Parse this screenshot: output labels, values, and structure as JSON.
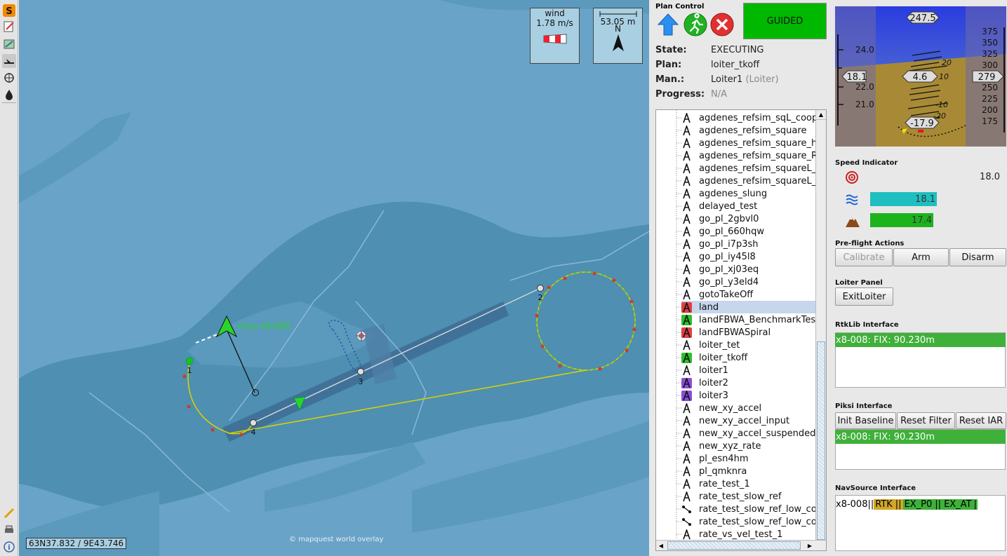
{
  "map": {
    "wind_label": "wind",
    "wind_speed": "1.78 m/s",
    "scale_value": "53.05 m",
    "north_label": "N",
    "aircraft_label": "ntnu-x8-008",
    "coordinates": "63N37.832 / 9E43.746",
    "credit": "© mapquest world overlay",
    "waypoints": [
      "1",
      "2",
      "3",
      "4"
    ]
  },
  "plan_control": {
    "title": "Plan Control",
    "mode": "GUIDED",
    "state_label": "State:",
    "state_value": "EXECUTING",
    "plan_label": "Plan:",
    "plan_value": "loiter_tkoff",
    "man_label": "Man.:",
    "man_value": "Loiter1",
    "man_type": "(Loiter)",
    "progress_label": "Progress:",
    "progress_value": "N/A"
  },
  "plans": [
    {
      "name": "agdenes_refsim_sqL_coop",
      "icon": "plan-icon",
      "color": "#111"
    },
    {
      "name": "agdenes_refsim_square",
      "icon": "plan-icon",
      "color": "#111"
    },
    {
      "name": "agdenes_refsim_square_he",
      "icon": "plan-icon",
      "color": "#111"
    },
    {
      "name": "agdenes_refsim_square_RT",
      "icon": "plan-icon",
      "color": "#111"
    },
    {
      "name": "agdenes_refsim_squareL_c",
      "icon": "plan-icon",
      "color": "#111"
    },
    {
      "name": "agdenes_refsim_squareL_R",
      "icon": "plan-icon",
      "color": "#111"
    },
    {
      "name": "agdenes_slung",
      "icon": "plan-icon",
      "color": "#111"
    },
    {
      "name": "delayed_test",
      "icon": "plan-icon",
      "color": "#111"
    },
    {
      "name": "go_pl_2gbvl0",
      "icon": "plan-icon",
      "color": "#111"
    },
    {
      "name": "go_pl_660hqw",
      "icon": "plan-icon",
      "color": "#111"
    },
    {
      "name": "go_pl_i7p3sh",
      "icon": "plan-icon",
      "color": "#111"
    },
    {
      "name": "go_pl_iy45l8",
      "icon": "plan-icon",
      "color": "#111"
    },
    {
      "name": "go_pl_xj03eq",
      "icon": "plan-icon",
      "color": "#111"
    },
    {
      "name": "go_pl_y3eld4",
      "icon": "plan-icon",
      "color": "#111"
    },
    {
      "name": "gotoTakeOff",
      "icon": "plan-icon",
      "color": "#111"
    },
    {
      "name": "land",
      "icon": "plan-icon-red",
      "color": "#e04040",
      "selected": true
    },
    {
      "name": "landFBWA_BenchmarkTest",
      "icon": "plan-icon-green",
      "color": "#2dbf2d"
    },
    {
      "name": "landFBWASpiral",
      "icon": "plan-icon-red",
      "color": "#e04040"
    },
    {
      "name": "loiter_tet",
      "icon": "plan-icon",
      "color": "#111"
    },
    {
      "name": "loiter_tkoff",
      "icon": "plan-icon-green",
      "color": "#2dbf2d"
    },
    {
      "name": "loiter1",
      "icon": "plan-icon",
      "color": "#111"
    },
    {
      "name": "loiter2",
      "icon": "plan-icon-purple",
      "color": "#8a4fd8"
    },
    {
      "name": "loiter3",
      "icon": "plan-icon-purple",
      "color": "#8a4fd8"
    },
    {
      "name": "new_xy_accel",
      "icon": "plan-icon",
      "color": "#111"
    },
    {
      "name": "new_xy_accel_input",
      "icon": "plan-icon",
      "color": "#111"
    },
    {
      "name": "new_xy_accel_suspended",
      "icon": "plan-icon",
      "color": "#111"
    },
    {
      "name": "new_xyz_rate",
      "icon": "plan-icon",
      "color": "#111"
    },
    {
      "name": "pl_esn4hm",
      "icon": "plan-icon",
      "color": "#111"
    },
    {
      "name": "pl_qmknra",
      "icon": "plan-icon",
      "color": "#111"
    },
    {
      "name": "rate_test_1",
      "icon": "plan-icon",
      "color": "#111"
    },
    {
      "name": "rate_test_slow_ref",
      "icon": "plan-icon",
      "color": "#111"
    },
    {
      "name": "rate_test_slow_ref_low_cop",
      "icon": "branch-icon",
      "color": "#111"
    },
    {
      "name": "rate_test_slow_ref_low_cop",
      "icon": "branch-icon",
      "color": "#111"
    },
    {
      "name": "rate_vs_vel_test_1",
      "icon": "plan-icon",
      "color": "#111"
    }
  ],
  "pfd": {
    "speed_tape": [
      "24.0",
      "22.0",
      "21.0"
    ],
    "speed_value": "18.1",
    "heading": "247.5",
    "pitch_value": "4.6",
    "roll_value": "-17.9",
    "pitch_ticks": [
      "20",
      "10",
      "-10",
      "-20"
    ],
    "altitude_tape": [
      "375",
      "350",
      "325",
      "300",
      "250",
      "225",
      "200",
      "175"
    ],
    "altitude_value": "279"
  },
  "speed_indicator": {
    "title": "Speed Indicator",
    "target": "18.0",
    "airspeed": "18.1",
    "airspeed_fraction": 0.9,
    "groundspeed": "17.4",
    "groundspeed_fraction": 0.85
  },
  "preflight": {
    "title": "Pre-flight Actions",
    "calibrate": "Calibrate",
    "arm": "Arm",
    "disarm": "Disarm"
  },
  "loiter": {
    "title": "Loiter Panel",
    "exit": "ExitLoiter"
  },
  "rtklib": {
    "title": "RtkLib Interface",
    "status": "x8-008: FIX: 90.230m"
  },
  "piksi": {
    "title": "Piksi Interface",
    "init": "Init Baseline",
    "reset_filter": "Reset Filter",
    "reset_iar": "Reset IAR",
    "status": "x8-008: FIX: 90.230m"
  },
  "navsource": {
    "title": "NavSource Interface",
    "vehicle": "x8-008",
    "sources": [
      "RTK",
      "EX_P0",
      "EX_AT"
    ],
    "colors": [
      "#d4a628",
      "#3fb03a",
      "#3fb03a"
    ]
  },
  "colors": {
    "map_water": "#69a4c8",
    "land": "#4b88a8",
    "mode_green": "#00b800",
    "accent_green": "#3fb03a",
    "speed_cyan": "#1fbfc0",
    "speed_green": "#1db31d"
  }
}
